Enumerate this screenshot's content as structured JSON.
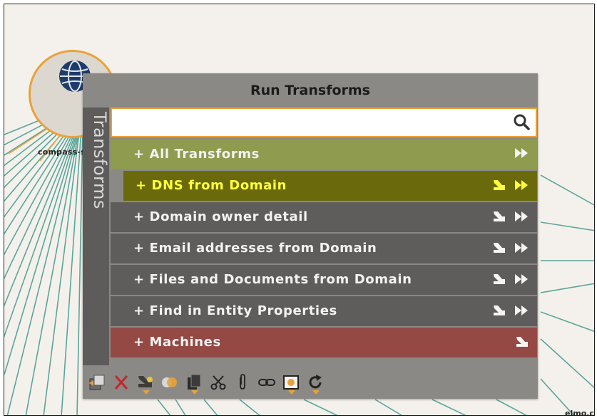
{
  "graph": {
    "node_label": "compass-sec",
    "node_icon": "globe-icon",
    "right_node_label": "elmo.c"
  },
  "panel": {
    "title": "Run Transforms",
    "side_tab": "Transforms",
    "search": {
      "value": "",
      "placeholder": ""
    },
    "rows": [
      {
        "label": "+ All Transforms",
        "style": "group",
        "icons": [
          "run-icon"
        ]
      },
      {
        "label": "+ DNS from Domain",
        "style": "highlighted",
        "icons": [
          "settings-icon",
          "run-icon"
        ]
      },
      {
        "label": "+ Domain owner detail",
        "style": "default",
        "icons": [
          "settings-icon",
          "run-icon"
        ]
      },
      {
        "label": "+ Email addresses from Domain",
        "style": "default",
        "icons": [
          "settings-icon",
          "run-icon"
        ]
      },
      {
        "label": "+ Files and Documents from Domain",
        "style": "default",
        "icons": [
          "settings-icon",
          "run-icon"
        ]
      },
      {
        "label": "+ Find in Entity Properties",
        "style": "default",
        "icons": [
          "settings-icon",
          "run-icon"
        ]
      },
      {
        "label": "+ Machines",
        "style": "machines",
        "icons": [
          "settings-icon"
        ]
      }
    ],
    "toolbar": [
      "copy-to-new-graph-icon",
      "delete-icon",
      "change-type-icon",
      "merge-icon",
      "copy-icon",
      "cut-icon",
      "attach-icon",
      "link-icon",
      "select-icon",
      "refresh-icon"
    ]
  },
  "colors": {
    "accent": "#e8a23a",
    "group_row": "#8f9c50",
    "highlight_row": "#6a6a0d",
    "highlight_text": "#ffff3c",
    "default_row": "#5f5d5b",
    "machines_row": "#944944",
    "edges": "#5aa59a"
  }
}
